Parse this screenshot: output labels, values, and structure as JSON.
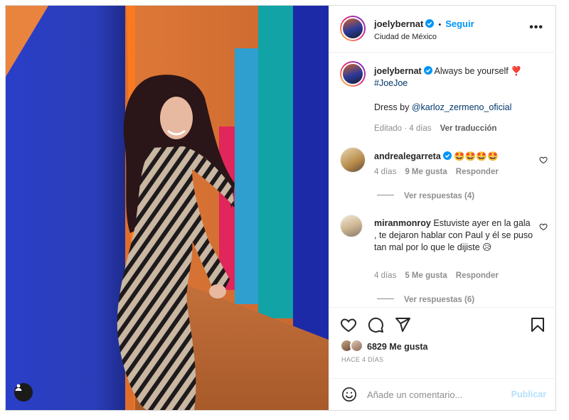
{
  "post": {
    "author": "joelybernat",
    "follow_label": "Seguir",
    "location": "Ciudad de México",
    "more_label": "•••",
    "caption_text": "Always be yourself",
    "caption_hashtag": "#JoeJoe",
    "caption_dress_prefix": "Dress by",
    "caption_dress_mention": "@karloz_zermeno_oficial",
    "caption_meta": "Editado · 4 días",
    "see_translation": "Ver traducción",
    "caption_emoji": "❣️"
  },
  "comments": [
    {
      "username": "andrealegarreta",
      "text": "🤩🤩🤩🤩",
      "time": "4 días",
      "likes": "9 Me gusta",
      "reply_label": "Responder",
      "view_replies": "Ver respuestas (4)"
    },
    {
      "username": "miranmonroy",
      "text": "Estuviste ayer en la gala , te dejaron hablar con Paul y él se puso tan mal por lo que le dijiste 😥",
      "time": "4 días",
      "likes": "5 Me gusta",
      "reply_label": "Responder",
      "view_replies": "Ver respuestas (6)"
    }
  ],
  "engagement": {
    "likes": "6829 Me gusta",
    "date": "HACE 4 DÍAS"
  },
  "add_comment": {
    "placeholder": "Añade un comentario...",
    "post_label": "Publicar"
  },
  "icons": {
    "verified": "verified-badge-icon",
    "like": "heart-icon",
    "comment": "comment-icon",
    "share": "paper-plane-icon",
    "save": "bookmark-icon",
    "emoji": "smiley-icon",
    "tag": "user-tag-icon"
  },
  "colors": {
    "accent": "#0095f6",
    "verified": "#0095f6",
    "text": "#262626",
    "muted": "#8e8e8e"
  }
}
